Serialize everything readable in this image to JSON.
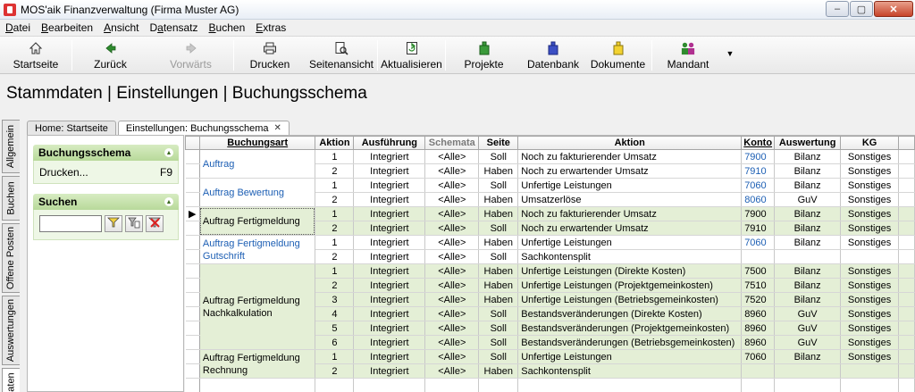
{
  "window": {
    "title": "MOS'aik Finanzverwaltung (Firma Muster AG)",
    "min_label": "–",
    "max_label": "▢",
    "close_label": "✕"
  },
  "menu": [
    {
      "label": "Datei",
      "accel": "D",
      "rest": "atei"
    },
    {
      "label": "Bearbeiten",
      "accel": "B",
      "rest": "earbeiten"
    },
    {
      "label": "Ansicht",
      "accel": "A",
      "rest": "nsicht"
    },
    {
      "label": "Datensatz",
      "accel": "D",
      "rest": "atensatz",
      "pre": "",
      "mid": "a"
    },
    {
      "label": "Buchen",
      "accel": "B",
      "rest": "uchen"
    },
    {
      "label": "Extras",
      "accel": "E",
      "rest": "xtras"
    }
  ],
  "toolbar": {
    "startseite": "Startseite",
    "zurueck": "Zurück",
    "vorwaerts": "Vorwärts",
    "drucken": "Drucken",
    "seitenansicht": "Seitenansicht",
    "aktualisieren": "Aktualisieren",
    "projekte": "Projekte",
    "datenbank": "Datenbank",
    "dokumente": "Dokumente",
    "mandant": "Mandant",
    "arrow": "▼"
  },
  "page_title": "Stammdaten | Einstellungen | Buchungsschema",
  "side_tabs": [
    "Allgemein",
    "Buchen",
    "Offene Posten",
    "Auswertungen",
    "Daten"
  ],
  "doc_tabs": {
    "home": "Home: Startseite",
    "current": "Einstellungen: Buchungsschema",
    "close": "✕"
  },
  "left_panel": {
    "buchungsschema_title": "Buchungsschema",
    "print_label": "Drucken...",
    "print_shortcut": "F9",
    "search_title": "Suchen",
    "collapse_glyph": "▲"
  },
  "table": {
    "headers": {
      "buchungsart": "Buchungsart",
      "aktion_nr": "Aktion",
      "ausfuehrung": "Ausführung",
      "schemata": "Schemata",
      "seite": "Seite",
      "aktion": "Aktion",
      "konto": "Konto",
      "auswertung": "Auswertung",
      "kg": "KG"
    },
    "groups": [
      {
        "name": "Auftrag",
        "rows": [
          {
            "n": "1",
            "exec": "Integriert",
            "schema": "<Alle>",
            "seite": "Soll",
            "aktion": "Noch zu fakturierender Umsatz",
            "konto": "7900",
            "ausw": "Bilanz",
            "kg": "Sonstiges"
          },
          {
            "n": "2",
            "exec": "Integriert",
            "schema": "<Alle>",
            "seite": "Haben",
            "aktion": "Noch zu erwartender Umsatz",
            "konto": "7910",
            "ausw": "Bilanz",
            "kg": "Sonstiges"
          }
        ]
      },
      {
        "name": "Auftrag Bewertung",
        "rows": [
          {
            "n": "1",
            "exec": "Integriert",
            "schema": "<Alle>",
            "seite": "Soll",
            "aktion": "Unfertige Leistungen",
            "konto": "7060",
            "ausw": "Bilanz",
            "kg": "Sonstiges"
          },
          {
            "n": "2",
            "exec": "Integriert",
            "schema": "<Alle>",
            "seite": "Haben",
            "aktion": "Umsatzerlöse",
            "konto": "8060",
            "ausw": "GuV",
            "kg": "Sonstiges"
          }
        ]
      },
      {
        "name": "Auftrag Fertigmeldung",
        "rows": [
          {
            "n": "1",
            "exec": "Integriert",
            "schema": "<Alle>",
            "seite": "Haben",
            "aktion": "Noch zu fakturierender Umsatz",
            "konto": "7900",
            "ausw": "Bilanz",
            "kg": "Sonstiges"
          },
          {
            "n": "2",
            "exec": "Integriert",
            "schema": "<Alle>",
            "seite": "Soll",
            "aktion": "Noch zu erwartender Umsatz",
            "konto": "7910",
            "ausw": "Bilanz",
            "kg": "Sonstiges"
          }
        ]
      },
      {
        "name": "Auftrag Fertigmeldung Gutschrift",
        "rows": [
          {
            "n": "1",
            "exec": "Integriert",
            "schema": "<Alle>",
            "seite": "Haben",
            "aktion": "Unfertige Leistungen",
            "konto": "7060",
            "ausw": "Bilanz",
            "kg": "Sonstiges"
          },
          {
            "n": "2",
            "exec": "Integriert",
            "schema": "<Alle>",
            "seite": "Soll",
            "aktion": "Sachkontensplit",
            "konto": "",
            "ausw": "",
            "kg": ""
          }
        ]
      },
      {
        "name": "Auftrag Fertigmeldung Nachkalkulation",
        "rows": [
          {
            "n": "1",
            "exec": "Integriert",
            "schema": "<Alle>",
            "seite": "Haben",
            "aktion": "Unfertige Leistungen (Direkte Kosten)",
            "konto": "7500",
            "ausw": "Bilanz",
            "kg": "Sonstiges"
          },
          {
            "n": "2",
            "exec": "Integriert",
            "schema": "<Alle>",
            "seite": "Haben",
            "aktion": "Unfertige Leistungen (Projektgemeinkosten)",
            "konto": "7510",
            "ausw": "Bilanz",
            "kg": "Sonstiges"
          },
          {
            "n": "3",
            "exec": "Integriert",
            "schema": "<Alle>",
            "seite": "Haben",
            "aktion": "Unfertige Leistungen (Betriebsgemeinkosten)",
            "konto": "7520",
            "ausw": "Bilanz",
            "kg": "Sonstiges"
          },
          {
            "n": "4",
            "exec": "Integriert",
            "schema": "<Alle>",
            "seite": "Soll",
            "aktion": "Bestandsveränderungen (Direkte Kosten)",
            "konto": "8960",
            "ausw": "GuV",
            "kg": "Sonstiges"
          },
          {
            "n": "5",
            "exec": "Integriert",
            "schema": "<Alle>",
            "seite": "Soll",
            "aktion": "Bestandsveränderungen (Projektgemeinkosten)",
            "konto": "8960",
            "ausw": "GuV",
            "kg": "Sonstiges"
          },
          {
            "n": "6",
            "exec": "Integriert",
            "schema": "<Alle>",
            "seite": "Soll",
            "aktion": "Bestandsveränderungen (Betriebsgemeinkosten)",
            "konto": "8960",
            "ausw": "GuV",
            "kg": "Sonstiges"
          }
        ]
      },
      {
        "name": "Auftrag Fertigmeldung Rechnung",
        "rows": [
          {
            "n": "1",
            "exec": "Integriert",
            "schema": "<Alle>",
            "seite": "Soll",
            "aktion": "Unfertige Leistungen",
            "konto": "7060",
            "ausw": "Bilanz",
            "kg": "Sonstiges"
          },
          {
            "n": "2",
            "exec": "Integriert",
            "schema": "<Alle>",
            "seite": "Haben",
            "aktion": "Sachkontensplit",
            "konto": "",
            "ausw": "",
            "kg": ""
          }
        ]
      }
    ]
  },
  "colors": {
    "green_row": "#e4efd6",
    "link_blue": "#1d5fb4",
    "panel_green": "#b8d99a"
  }
}
